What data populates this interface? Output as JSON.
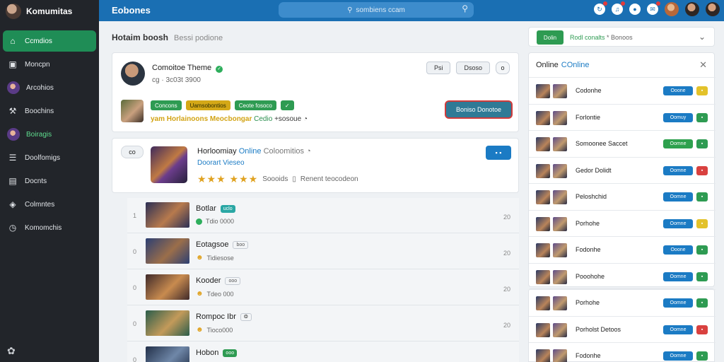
{
  "app": {
    "brand": "Komumitas"
  },
  "sidebar": {
    "items": [
      {
        "label": "Ccmdios",
        "icon": "home-icon",
        "glyph": "⌂",
        "active": true
      },
      {
        "label": "Moncpn",
        "icon": "building-icon",
        "glyph": "▣"
      },
      {
        "label": "Arcohios",
        "icon": "user-avatar-icon",
        "glyph": ""
      },
      {
        "label": "Boochins",
        "icon": "wrench-icon",
        "glyph": "⚒"
      },
      {
        "label": "Boiragis",
        "icon": "user-avatar-icon",
        "glyph": "",
        "highlight": true
      },
      {
        "label": "Doolfomigs",
        "icon": "list-icon",
        "glyph": "☰"
      },
      {
        "label": "Docnts",
        "icon": "document-icon",
        "glyph": "▤"
      },
      {
        "label": "Colmntes",
        "icon": "shield-icon",
        "glyph": "◈"
      },
      {
        "label": "Komomchis",
        "icon": "clock-icon",
        "glyph": "◷"
      }
    ],
    "footer_icon": "puzzle-icon"
  },
  "topbar": {
    "title": "Eobones",
    "search_text": "sombiens ccam",
    "icons": [
      "refresh-icon",
      "bell-icon",
      "chat-icon",
      "notification-icon"
    ]
  },
  "main": {
    "heading": "Hotaim boosh",
    "heading_sub": "Bessi podione"
  },
  "profile": {
    "name": "Comoitoe Theme",
    "subtitle": "cg  ·  3c03t 3900",
    "btn1": "Psi",
    "btn2": "Dsoso",
    "btn3": "o",
    "tags": [
      {
        "label": "Concons",
        "color": "green"
      },
      {
        "label": "Uamsobontios",
        "color": "yellow"
      },
      {
        "label": "Ceote fosoco",
        "color": "green"
      },
      {
        "label": "✓",
        "color": "green"
      }
    ],
    "meta_prefix": "yam",
    "meta_highlight": "Horlainoons Meocbongar",
    "meta_green": "Cedio",
    "meta_rest": "+sosoue",
    "action": "Boniso Donotoe"
  },
  "feature": {
    "pill": "co",
    "title": "Horloomiay",
    "title_blue": "Online",
    "title_gray": "Coloomitios",
    "subtitle": "Doorart Vieseo",
    "stars": "★★★ ★★★",
    "rating_text": "Soooids",
    "rating_extra": "Renent teocodeon",
    "btn": "▪ ▪"
  },
  "list": [
    {
      "num": "1",
      "title": "Botlar",
      "badge": "uclo",
      "badge_style": "teal",
      "sub_icon": "dot",
      "sub": "Tdio 0000",
      "count": "20",
      "colors": [
        "#2b2f55",
        "#b77a4d"
      ]
    },
    {
      "num": "0",
      "title": "Eotagsoe",
      "badge": "boo",
      "badge_style": "plain",
      "sub_icon": "smile",
      "sub": "Tidiesose",
      "count": "20",
      "colors": [
        "#2c3f73",
        "#9b6e4a"
      ]
    },
    {
      "num": "0",
      "title": "Kooder",
      "badge": "ooo",
      "badge_style": "plain",
      "sub_icon": "smile",
      "sub": "Tdeo 000",
      "count": "20",
      "colors": [
        "#3f2a2a",
        "#c88b4f"
      ]
    },
    {
      "num": "0",
      "title": "Rompoc Ibr",
      "badge": "❂",
      "badge_style": "plain",
      "sub_icon": "smile",
      "sub": "Tioco000",
      "count": "20",
      "colors": [
        "#2a5d4b",
        "#c39a5a"
      ]
    },
    {
      "num": "0",
      "title": "Hobon",
      "badge": "ooo",
      "badge_style": "green",
      "sub_icon": "none",
      "sub": "",
      "count": "",
      "colors": [
        "#223049",
        "#6f87a8"
      ]
    }
  ],
  "filter": {
    "btn": "Dolin",
    "text_green": "Rodl conalts",
    "text_rest": "* Bonoos"
  },
  "online": {
    "title": "Online",
    "title_blue": "COnline",
    "rows": [
      {
        "name": "Codonhe",
        "btn": "Ooone",
        "btn_color": "blue",
        "sq": "yellow"
      },
      {
        "name": "Forlontie",
        "btn": "Oomuy",
        "btn_color": "blue",
        "sq": "green"
      },
      {
        "name": "Somoonee Saccet",
        "btn": "Oomne",
        "btn_color": "green",
        "sq": "green"
      },
      {
        "name": "Gedor Dolidt",
        "btn": "Oomne",
        "btn_color": "blue",
        "sq": "red"
      },
      {
        "name": "Peloshchid",
        "btn": "Oomne",
        "btn_color": "blue",
        "sq": "green"
      },
      {
        "name": "Porhohe",
        "btn": "Oomne",
        "btn_color": "blue",
        "sq": "yellow"
      },
      {
        "name": "Fodonhe",
        "btn": "Ooone",
        "btn_color": "blue",
        "sq": "green"
      },
      {
        "name": "Pooohohe",
        "btn": "Oomne",
        "btn_color": "blue",
        "sq": "green"
      }
    ],
    "rows2": [
      {
        "name": "Porhohe",
        "btn": "Oomne",
        "btn_color": "blue",
        "sq": "green"
      },
      {
        "name": "Porholst Detoos",
        "btn": "Oomne",
        "btn_color": "blue",
        "sq": "red"
      },
      {
        "name": "Fodonhe",
        "btn": "Oomne",
        "btn_color": "blue",
        "sq": "green"
      }
    ]
  }
}
